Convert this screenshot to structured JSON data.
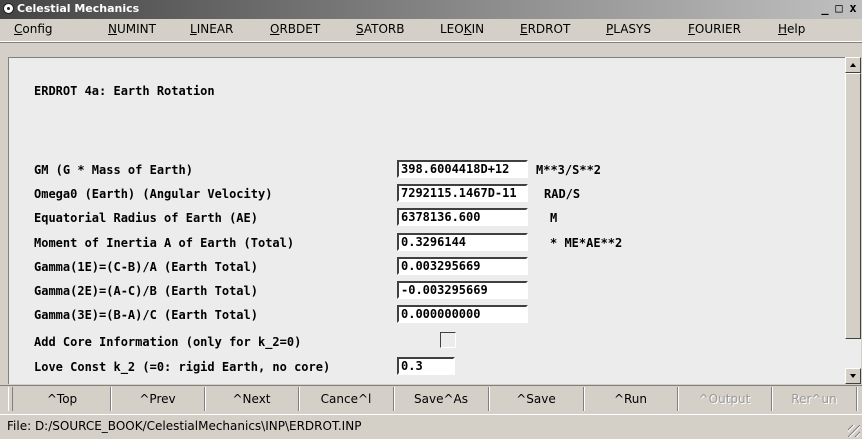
{
  "window": {
    "title": "Celestial Mechanics",
    "controls": {
      "minimize": "_",
      "maximize": "□",
      "close": "x"
    }
  },
  "menu": {
    "items": [
      {
        "label": "Config",
        "accel": "C",
        "rest": "onfig"
      },
      {
        "label": "NUMINT",
        "accel": "N",
        "rest": "UMINT"
      },
      {
        "label": "LINEAR",
        "accel": "L",
        "rest": "INEAR"
      },
      {
        "label": "ORBDET",
        "accel": "O",
        "rest": "RBDET"
      },
      {
        "label": "SATORB",
        "accel": "S",
        "rest": "ATORB"
      },
      {
        "label": "LEOKIN",
        "pre": "LEO",
        "accel": "K",
        "rest": "IN"
      },
      {
        "label": "ERDROT",
        "accel": "E",
        "rest": "RDROT"
      },
      {
        "label": "PLASYS",
        "accel": "P",
        "rest": "LASYS"
      },
      {
        "label": "FOURIER",
        "accel": "F",
        "rest": "OURIER"
      },
      {
        "label": "Help",
        "accel": "H",
        "rest": "elp"
      }
    ]
  },
  "form": {
    "heading": "ERDROT 4a: Earth Rotation",
    "rows": [
      {
        "label": "GM (G * Mass of Earth)",
        "value": "398.6004418D+12",
        "unit": "M**3/S**2"
      },
      {
        "label": "Omega0 (Earth) (Angular Velocity)",
        "value": "7292115.1467D-11",
        "unit": "RAD/S"
      },
      {
        "label": "Equatorial Radius of Earth (AE)",
        "value": "6378136.600",
        "unit": "M"
      },
      {
        "label": "Moment of Inertia A of Earth (Total)",
        "value": "0.3296144",
        "unit": "* ME*AE**2"
      },
      {
        "label": "Gamma(1E)=(C-B)/A (Earth Total)",
        "value": "0.003295669",
        "unit": ""
      },
      {
        "label": "Gamma(2E)=(A-C)/B (Earth Total)",
        "value": "-0.003295669",
        "unit": ""
      },
      {
        "label": "Gamma(3E)=(B-A)/C (Earth Total)",
        "value": "0.000000000",
        "unit": ""
      }
    ],
    "core_label": "Add Core Information (only for k_2=0)",
    "core_checked": false,
    "love_label": "Love Const k_2 (=0: rigid Earth, no core)",
    "love_value": "0.3"
  },
  "buttons": [
    {
      "label": "^Top",
      "enabled": true
    },
    {
      "label": "^Prev",
      "enabled": true
    },
    {
      "label": "^Next",
      "enabled": true
    },
    {
      "label": "Cance^l",
      "enabled": true
    },
    {
      "label": "Save^As",
      "enabled": true
    },
    {
      "label": "^Save",
      "enabled": true
    },
    {
      "label": "^Run",
      "enabled": true
    },
    {
      "label": "^Output",
      "enabled": false
    },
    {
      "label": "Rer^un",
      "enabled": false
    }
  ],
  "status": {
    "file": "File: D:/SOURCE_BOOK/CelestialMechanics\\INP\\ERDROT.INP"
  }
}
